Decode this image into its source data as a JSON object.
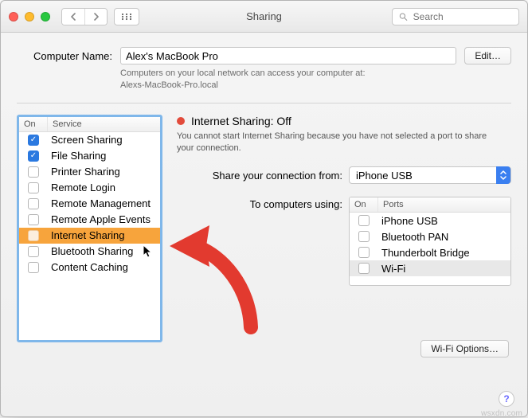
{
  "titlebar": {
    "title": "Sharing",
    "search_placeholder": "Search"
  },
  "computer_name": {
    "label": "Computer Name:",
    "value": "Alex's MacBook Pro",
    "hint_line1": "Computers on your local network can access your computer at:",
    "hint_line2": "Alexs-MacBook-Pro.local",
    "edit_label": "Edit…"
  },
  "services": {
    "col_on": "On",
    "col_service": "Service",
    "items": [
      {
        "label": "Screen Sharing",
        "checked": true,
        "selected": false
      },
      {
        "label": "File Sharing",
        "checked": true,
        "selected": false
      },
      {
        "label": "Printer Sharing",
        "checked": false,
        "selected": false
      },
      {
        "label": "Remote Login",
        "checked": false,
        "selected": false
      },
      {
        "label": "Remote Management",
        "checked": false,
        "selected": false
      },
      {
        "label": "Remote Apple Events",
        "checked": false,
        "selected": false
      },
      {
        "label": "Internet Sharing",
        "checked": false,
        "selected": true
      },
      {
        "label": "Bluetooth Sharing",
        "checked": false,
        "selected": false
      },
      {
        "label": "Content Caching",
        "checked": false,
        "selected": false
      }
    ]
  },
  "detail": {
    "status_title": "Internet Sharing: Off",
    "status_warn": "You cannot start Internet Sharing because you have not selected a port to share your connection.",
    "share_from_label": "Share your connection from:",
    "share_from_value": "iPhone USB",
    "to_using_label": "To computers using:",
    "ports": {
      "col_on": "On",
      "col_ports": "Ports",
      "items": [
        {
          "label": "iPhone USB",
          "checked": false,
          "hl": false
        },
        {
          "label": "Bluetooth PAN",
          "checked": false,
          "hl": false
        },
        {
          "label": "Thunderbolt Bridge",
          "checked": false,
          "hl": false
        },
        {
          "label": "Wi-Fi",
          "checked": false,
          "hl": true
        }
      ]
    },
    "wifi_options_label": "Wi-Fi Options…"
  },
  "watermark": "wsxdn.com"
}
